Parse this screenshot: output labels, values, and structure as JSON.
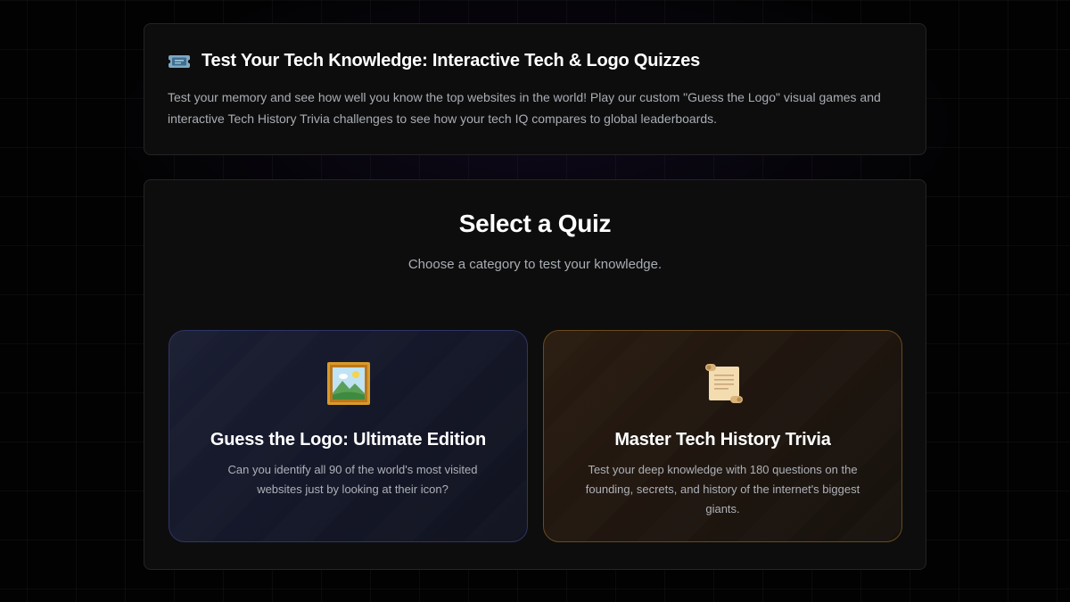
{
  "intro": {
    "icon": "ticket-icon",
    "title": "Test Your Tech Knowledge: Interactive Tech & Logo Quizzes",
    "description": "Test your memory and see how well you know the top websites in the world! Play our custom \"Guess the Logo\" visual games and interactive Tech History Trivia challenges to see how your tech IQ compares to global leaderboards."
  },
  "quiz_selector": {
    "title": "Select a Quiz",
    "subtitle": "Choose a category to test your knowledge.",
    "cards": [
      {
        "icon": "framed-picture-icon",
        "title": "Guess the Logo: Ultimate Edition",
        "description": "Can you identify all 90 of the world's most visited websites just by looking at their icon?",
        "accent_color": "#2f3566"
      },
      {
        "icon": "scroll-icon",
        "title": "Master Tech History Trivia",
        "description": "Test your deep knowledge with 180 questions on the founding, secrets, and history of the internet's biggest giants.",
        "accent_color": "#6b4a1c"
      }
    ]
  }
}
